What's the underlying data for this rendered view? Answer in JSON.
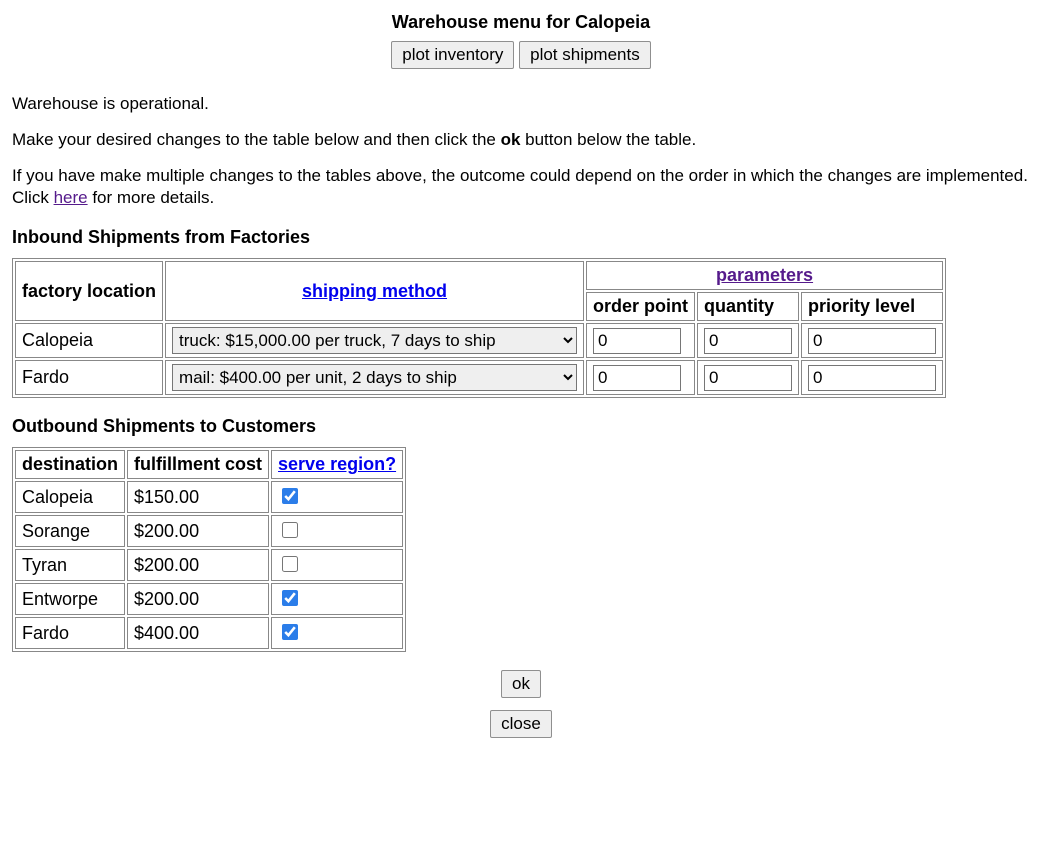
{
  "header": {
    "title": "Warehouse menu for Calopeia",
    "plot_inventory_label": "plot inventory",
    "plot_shipments_label": "plot shipments"
  },
  "status_text": "Warehouse is operational.",
  "instructions": {
    "line1_pre": "Make your desired changes to the table below and then click the ",
    "line1_bold": "ok",
    "line1_post": " button below the table.",
    "line2_pre": "If you have make multiple changes to the tables above, the outcome could depend on the order in which the changes are implemented. Click ",
    "line2_link": "here",
    "line2_post": " for more details."
  },
  "inbound": {
    "heading": "Inbound Shipments from Factories",
    "headers": {
      "factory_location": "factory location",
      "shipping_method": "shipping method",
      "parameters": "parameters",
      "order_point": "order point",
      "quantity": "quantity",
      "priority_level": "priority level"
    },
    "shipping_options": [
      "truck: $15,000.00 per truck, 7 days to ship",
      "mail: $400.00 per unit, 2 days to ship"
    ],
    "rows": [
      {
        "factory": "Calopeia",
        "shipping_selected": "truck: $15,000.00 per truck, 7 days to ship",
        "order_point": "0",
        "quantity": "0",
        "priority": "0"
      },
      {
        "factory": "Fardo",
        "shipping_selected": "mail: $400.00 per unit, 2 days to ship",
        "order_point": "0",
        "quantity": "0",
        "priority": "0"
      }
    ]
  },
  "outbound": {
    "heading": "Outbound Shipments to Customers",
    "headers": {
      "destination": "destination",
      "fulfillment_cost": "fulfillment cost",
      "serve_region": "serve region?"
    },
    "rows": [
      {
        "destination": "Calopeia",
        "cost": "$150.00",
        "serve": true
      },
      {
        "destination": "Sorange",
        "cost": "$200.00",
        "serve": false
      },
      {
        "destination": "Tyran",
        "cost": "$200.00",
        "serve": false
      },
      {
        "destination": "Entworpe",
        "cost": "$200.00",
        "serve": true
      },
      {
        "destination": "Fardo",
        "cost": "$400.00",
        "serve": true
      }
    ]
  },
  "buttons": {
    "ok": "ok",
    "close": "close"
  }
}
